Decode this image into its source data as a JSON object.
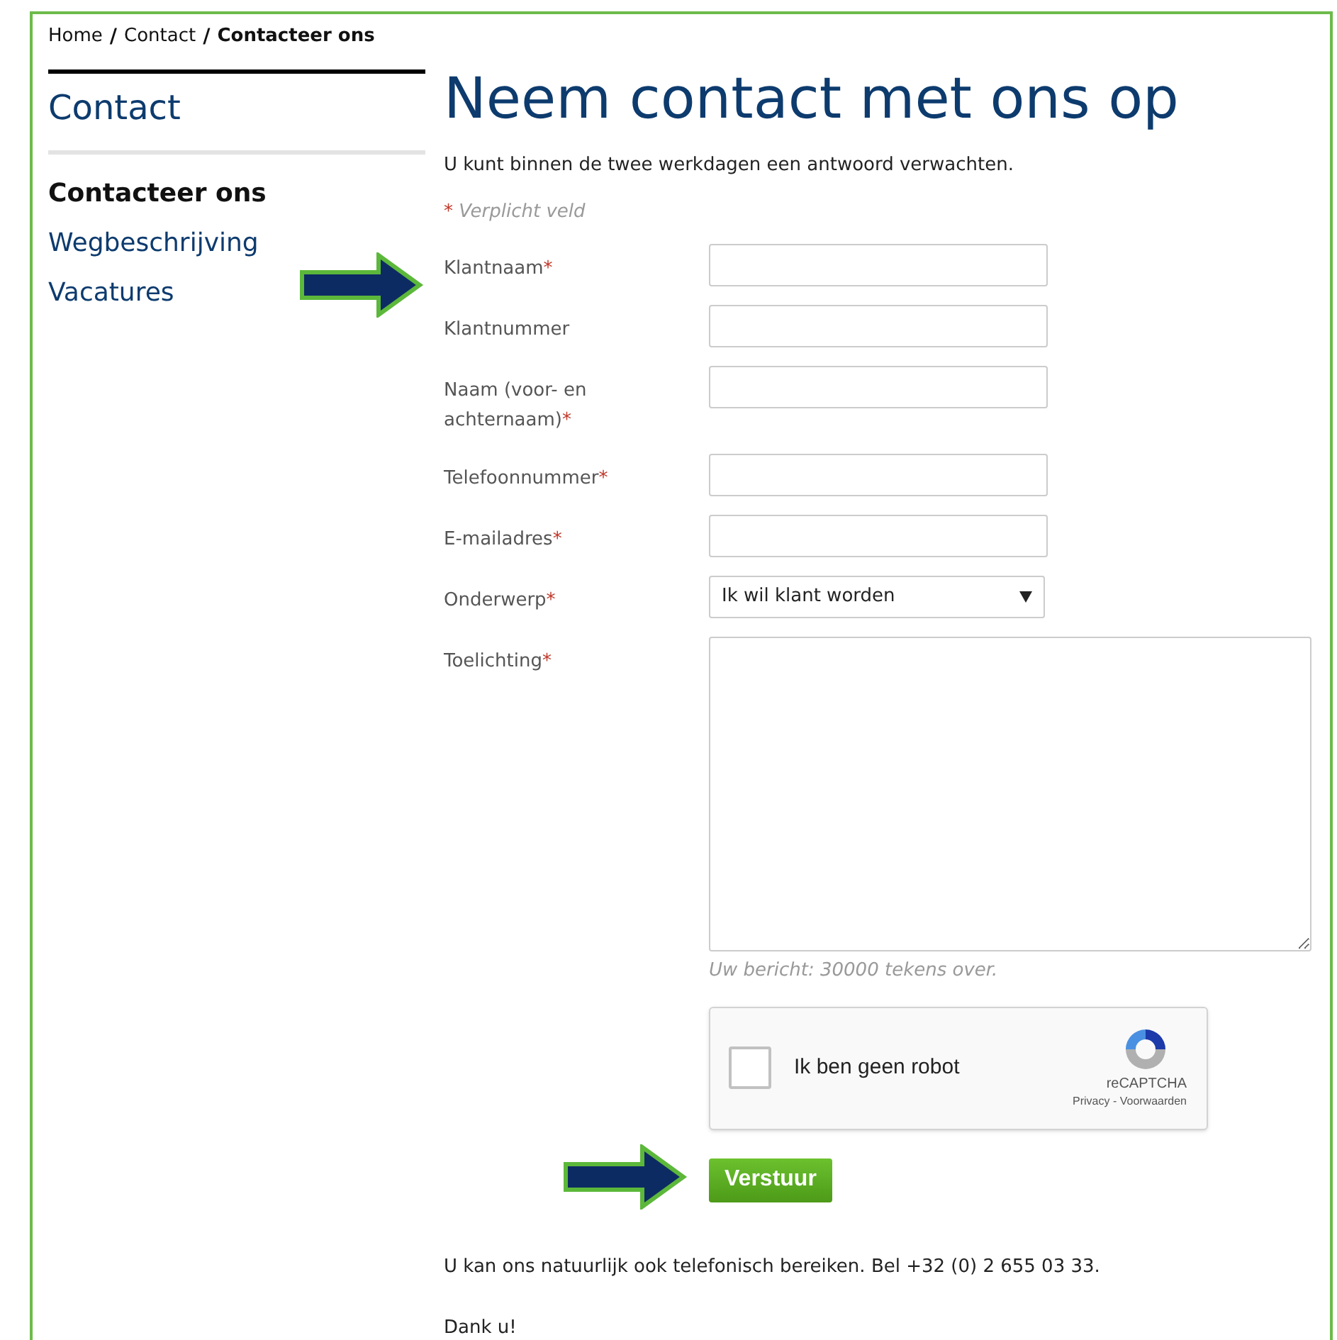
{
  "breadcrumb": [
    {
      "label": "Home",
      "current": false
    },
    {
      "label": "Contact",
      "current": false
    },
    {
      "label": "Contacteer ons",
      "current": true
    }
  ],
  "breadcrumb_separator": "/",
  "sidebar": {
    "title": "Contact",
    "items": [
      {
        "label": "Contacteer ons",
        "selected": true
      },
      {
        "label": "Wegbeschrijving",
        "selected": false
      },
      {
        "label": "Vacatures",
        "selected": false
      }
    ]
  },
  "heading": "Neem contact met ons op",
  "intro": "U kunt binnen de twee werkdagen een antwoord verwachten.",
  "required_note": {
    "mark": "*",
    "text": "Verplicht veld"
  },
  "fields": [
    {
      "kind": "text",
      "label": "Klantnaam",
      "mark": "*"
    },
    {
      "kind": "text",
      "label": "Klantnummer"
    },
    {
      "kind": "text",
      "label": "Naam (voor- en achternaam)",
      "mark": "*"
    },
    {
      "kind": "text",
      "label": "Telefoonnummer",
      "mark": "*"
    },
    {
      "kind": "text",
      "label": "E-mailadres",
      "mark": "*"
    },
    {
      "kind": "select",
      "label": "Onderwerp",
      "mark": "*",
      "value": "Ik wil klant worden"
    },
    {
      "kind": "textarea",
      "label": "Toelichting",
      "mark": "*"
    }
  ],
  "counter": "Uw bericht: 30000 tekens over.",
  "captcha": {
    "checked": false,
    "label": "Ik ben geen robot",
    "brand": "reCAPTCHA",
    "links": "Privacy - Voorwaarden"
  },
  "submit": "Verstuur",
  "footer_text": "U kan ons natuurlijk ook telefonisch bereiken. Bel +32 (0) 2 655 03 33.",
  "closing": "Dank u!"
}
